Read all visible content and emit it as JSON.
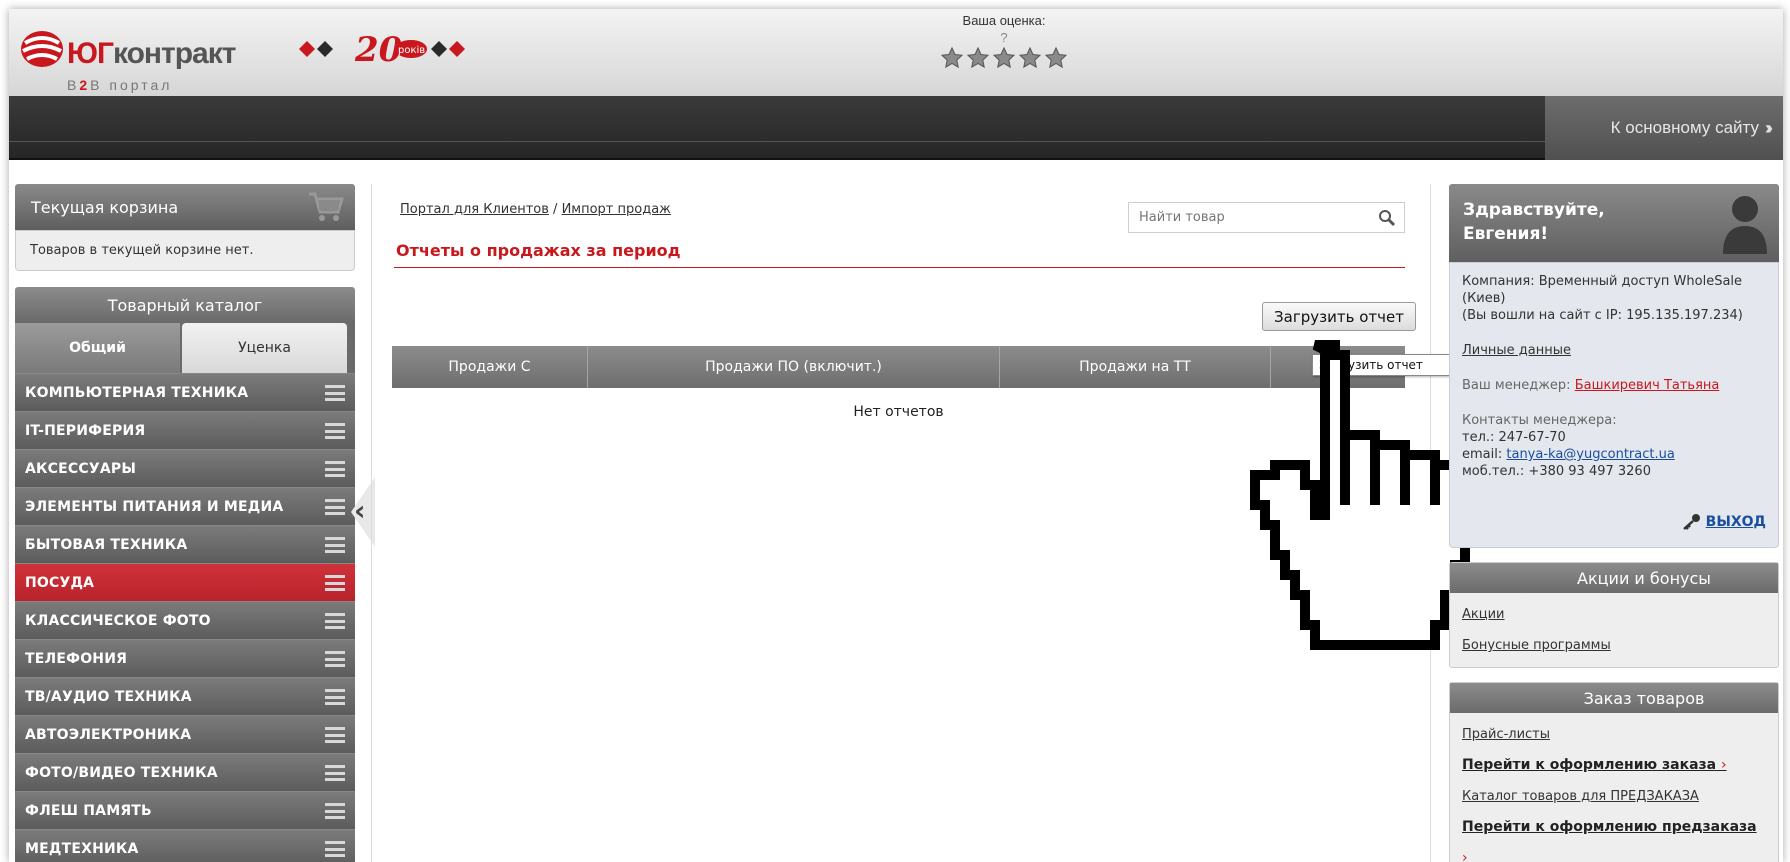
{
  "header": {
    "logo_main": "ЮГ",
    "logo_rest": "контракт",
    "logo_sub_prefix": "В",
    "logo_sub_num": "2",
    "logo_sub_suffix": "В портал",
    "jubilee_text": "20",
    "jubilee_sub": "років",
    "rating_label": "Ваша оценка:",
    "rating_value": "?",
    "stars_count": 5,
    "main_site_link": "К основному сайту"
  },
  "cart": {
    "title": "Текущая корзина",
    "message": "Товаров в текущей корзине нет."
  },
  "catalog": {
    "title": "Товарный каталог",
    "tabs": [
      {
        "label": "Общий",
        "active": true
      },
      {
        "label": "Уценка",
        "active": false
      }
    ],
    "items": [
      {
        "label": "КОМПЬЮТЕРНАЯ ТЕХНИКА",
        "active": false
      },
      {
        "label": "IT-ПЕРИФЕРИЯ",
        "active": false
      },
      {
        "label": "АКСЕССУАРЫ",
        "active": false
      },
      {
        "label": "ЭЛЕМЕНТЫ ПИТАНИЯ И МЕДИА",
        "active": false
      },
      {
        "label": "БЫТОВАЯ ТЕХНИКА",
        "active": false
      },
      {
        "label": "ПОСУДА",
        "active": true
      },
      {
        "label": "КЛАССИЧЕСКОЕ ФОТО",
        "active": false
      },
      {
        "label": "ТЕЛЕФОНИЯ",
        "active": false
      },
      {
        "label": "ТВ/АУДИО ТЕХНИКА",
        "active": false
      },
      {
        "label": "АВТОЭЛЕКТРОНИКА",
        "active": false
      },
      {
        "label": "ФОТО/ВИДЕО ТЕХНИКА",
        "active": false
      },
      {
        "label": "ФЛЕШ ПАМЯТЬ",
        "active": false
      },
      {
        "label": "МЕДТЕХНИКА",
        "active": false
      }
    ]
  },
  "breadcrumb": {
    "root": "Портал для Клиентов",
    "separator": "/",
    "current": "Импорт продаж"
  },
  "search": {
    "placeholder": "Найти товар"
  },
  "page": {
    "title": "Отчеты о продажах за период",
    "upload_button": "Загрузить отчет",
    "tooltip": "Загрузить отчет",
    "empty_message": "Нет отчетов"
  },
  "table": {
    "columns": [
      "Продажи С",
      "Продажи ПО (включит.)",
      "Продажи на ТТ",
      ""
    ]
  },
  "user": {
    "greeting": "Здравствуйте,",
    "name": "Евгения!",
    "company": "Компания: Временный доступ WholeSale (Киев)",
    "ip_note": "(Вы вошли на сайт с IP: 195.135.197.234)",
    "personal_data": "Личные данные",
    "manager_label": "Ваш менеджер:",
    "manager_name": "Башкиревич Татьяна",
    "contacts_label": "Контакты менеджера:",
    "phone": "тел.: 247-67-70",
    "email_label": "email:",
    "email": "tanya-ka@yugcontract.ua",
    "mobile": "моб.тел.: +380 93 497 3260",
    "logout": "ВЫХОД"
  },
  "promo": {
    "title": "Акции и бонусы",
    "links": [
      "Акции",
      "Бонусные программы"
    ]
  },
  "orders": {
    "title": "Заказ товаров",
    "links": [
      {
        "label": "Прайс-листы",
        "bold": false
      },
      {
        "label": "Перейти к оформлению заказа",
        "bold": true
      },
      {
        "label": "Каталог товаров для ПРЕДЗАКАЗА",
        "bold": false
      },
      {
        "label": "Перейти к оформлению предзаказа",
        "bold": true
      }
    ]
  },
  "colors": {
    "accent_red": "#c8181e",
    "header_dark": "#262626",
    "panel_gray": "#6a6a6a"
  }
}
